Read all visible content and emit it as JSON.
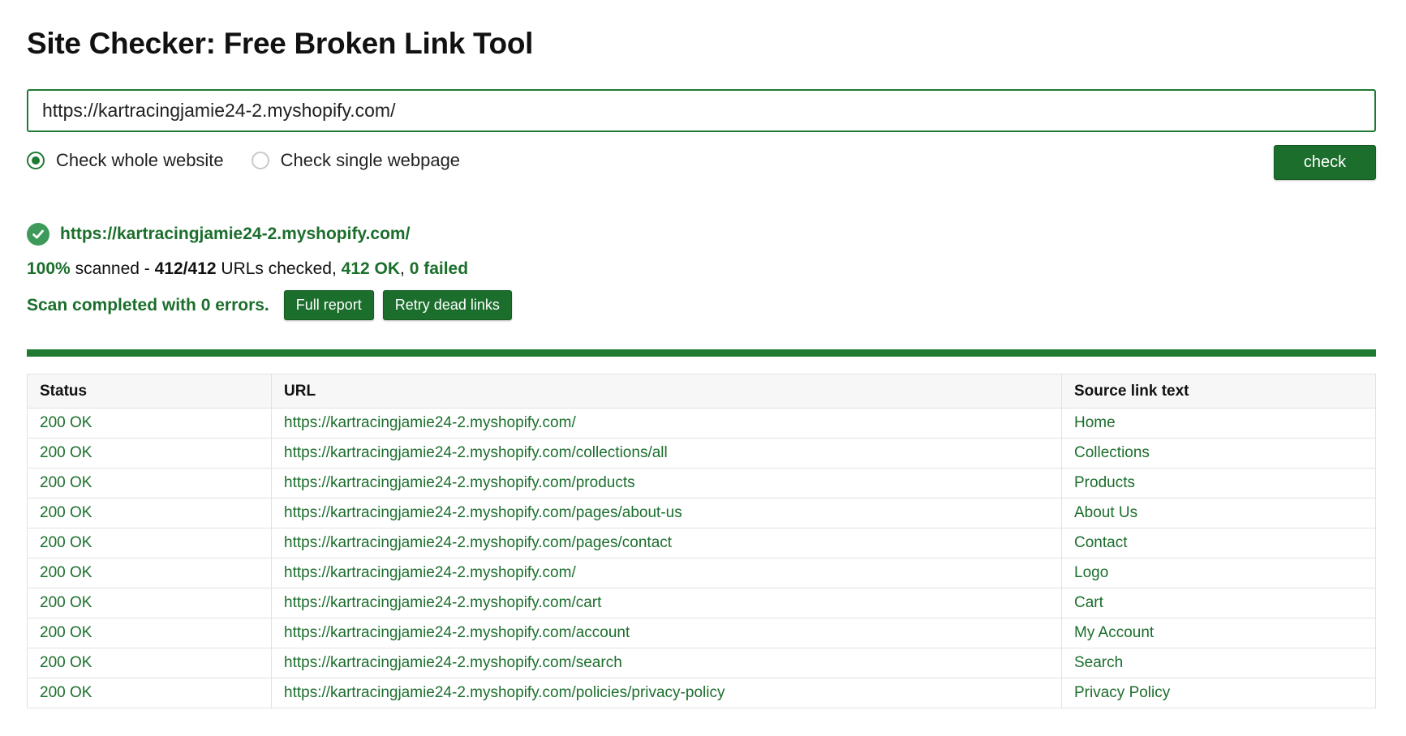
{
  "title": "Site Checker: Free Broken Link Tool",
  "url_input": {
    "value": "https://kartracingjamie24-2.myshopify.com/"
  },
  "modes": [
    {
      "label": "Check whole website",
      "selected": true
    },
    {
      "label": "Check single webpage",
      "selected": false
    }
  ],
  "check_button_label": "check",
  "result": {
    "url": "https://kartracingjamie24-2.myshopify.com/",
    "percent_scanned": "100%",
    "scanned_word": "scanned -",
    "checked_count": "412/412",
    "urls_checked_label": "URLs checked,",
    "ok_count": "412 OK",
    "failed_count": "0 failed",
    "progress_fraction": 1.0,
    "completion_message": "Scan completed with 0 errors.",
    "full_report_label": "Full report",
    "retry_label": "Retry dead links"
  },
  "table": {
    "headers": {
      "status": "Status",
      "url": "URL",
      "source": "Source link text"
    },
    "rows": [
      {
        "status": "200 OK",
        "url": "https://kartracingjamie24-2.myshopify.com/",
        "source": "Home"
      },
      {
        "status": "200 OK",
        "url": "https://kartracingjamie24-2.myshopify.com/collections/all",
        "source": "Collections"
      },
      {
        "status": "200 OK",
        "url": "https://kartracingjamie24-2.myshopify.com/products",
        "source": "Products"
      },
      {
        "status": "200 OK",
        "url": "https://kartracingjamie24-2.myshopify.com/pages/about-us",
        "source": "About Us"
      },
      {
        "status": "200 OK",
        "url": "https://kartracingjamie24-2.myshopify.com/pages/contact",
        "source": "Contact"
      },
      {
        "status": "200 OK",
        "url": "https://kartracingjamie24-2.myshopify.com/",
        "source": "Logo"
      },
      {
        "status": "200 OK",
        "url": "https://kartracingjamie24-2.myshopify.com/cart",
        "source": "Cart"
      },
      {
        "status": "200 OK",
        "url": "https://kartracingjamie24-2.myshopify.com/account",
        "source": "My Account"
      },
      {
        "status": "200 OK",
        "url": "https://kartracingjamie24-2.myshopify.com/search",
        "source": "Search"
      },
      {
        "status": "200 OK",
        "url": "https://kartracingjamie24-2.myshopify.com/policies/privacy-policy",
        "source": "Privacy Policy"
      }
    ]
  },
  "colors": {
    "accent": "#1b6e2c",
    "success_icon": "#3d9a5b"
  },
  "icons": {
    "status": "check-circle-icon"
  }
}
